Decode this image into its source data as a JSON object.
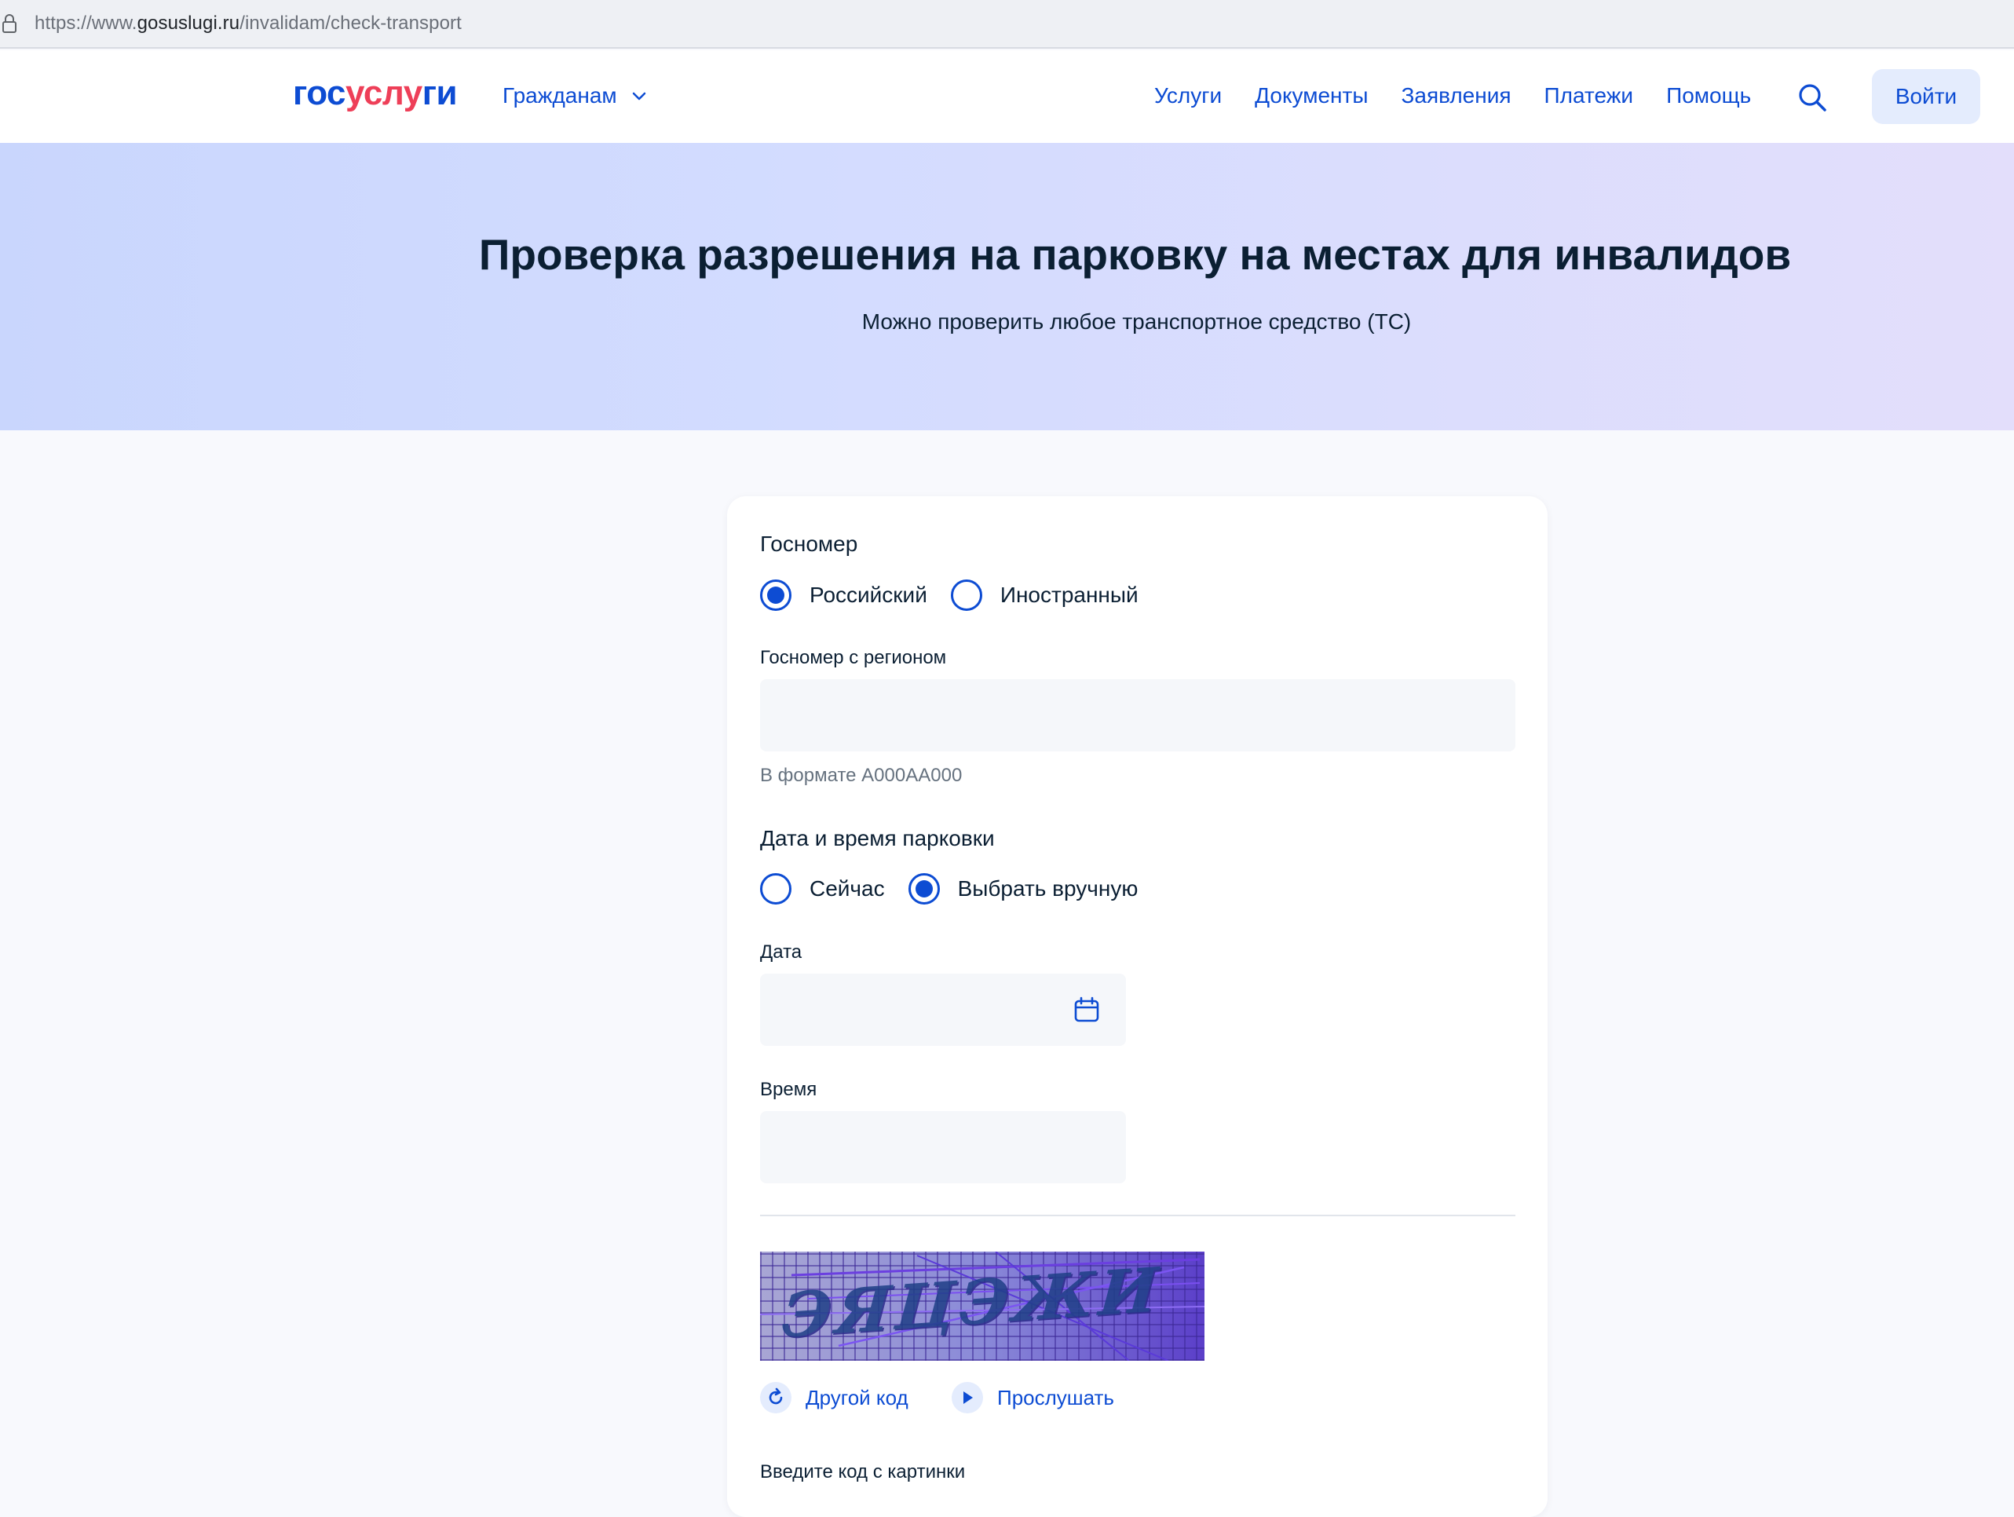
{
  "browser": {
    "url_prefix": "https://www.",
    "url_host": "gosuslugi.ru",
    "url_path": "/invalidam/check-transport"
  },
  "header": {
    "logo_part1": "гос",
    "logo_part2": "услу",
    "logo_part3": "ги",
    "role_label": "Гражданам",
    "nav": [
      "Услуги",
      "Документы",
      "Заявления",
      "Платежи",
      "Помощь"
    ],
    "login_label": "Войти"
  },
  "hero": {
    "title": "Проверка разрешения на парковку на местах для инвалидов",
    "subtitle": "Можно проверить любое транспортное средство (ТС)"
  },
  "form": {
    "plate_group_label": "Госномер",
    "plate_options": [
      {
        "label": "Российский",
        "checked": true
      },
      {
        "label": "Иностранный",
        "checked": false
      }
    ],
    "plate_field_label": "Госномер с регионом",
    "plate_field_value": "",
    "plate_hint": "В формате А000АА000",
    "datetime_group_label": "Дата и время парковки",
    "datetime_options": [
      {
        "label": "Сейчас",
        "checked": false
      },
      {
        "label": "Выбрать вручную",
        "checked": true
      }
    ],
    "date_label": "Дата",
    "date_value": "",
    "time_label": "Время",
    "time_value": "",
    "captcha_other_code": "Другой код",
    "captcha_listen": "Прослушать",
    "captcha_input_label": "Введите код с картинки",
    "captcha_text": "ЭЯЦЭЖИ"
  },
  "colors": {
    "accent": "#0d4cd3",
    "logo_red": "#ee3f58",
    "text": "#0b1f33",
    "input_bg": "#f5f7fa"
  }
}
